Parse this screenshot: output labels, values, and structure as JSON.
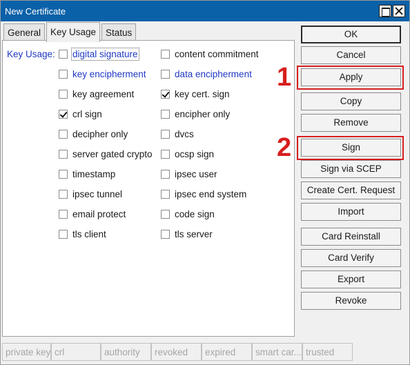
{
  "window": {
    "title": "New Certificate"
  },
  "tabs": [
    {
      "label": "General",
      "active": false
    },
    {
      "label": "Key Usage",
      "active": true
    },
    {
      "label": "Status",
      "active": false
    }
  ],
  "key_usage": {
    "label": "Key Usage:",
    "left": [
      {
        "label": "digital signature",
        "checked": false
      },
      {
        "label": "key encipherment",
        "checked": false
      },
      {
        "label": "key agreement",
        "checked": false
      },
      {
        "label": "crl sign",
        "checked": true
      },
      {
        "label": "decipher only",
        "checked": false
      },
      {
        "label": "server gated crypto",
        "checked": false
      },
      {
        "label": "timestamp",
        "checked": false
      },
      {
        "label": "ipsec tunnel",
        "checked": false
      },
      {
        "label": "email protect",
        "checked": false
      },
      {
        "label": "tls client",
        "checked": false
      }
    ],
    "right": [
      {
        "label": "content commitment",
        "checked": false
      },
      {
        "label": "data encipherment",
        "checked": false
      },
      {
        "label": "key cert. sign",
        "checked": true
      },
      {
        "label": "encipher only",
        "checked": false
      },
      {
        "label": "dvcs",
        "checked": false
      },
      {
        "label": "ocsp sign",
        "checked": false
      },
      {
        "label": "ipsec user",
        "checked": false
      },
      {
        "label": "ipsec end system",
        "checked": false
      },
      {
        "label": "code sign",
        "checked": false
      },
      {
        "label": "tls server",
        "checked": false
      }
    ]
  },
  "buttons": {
    "ok": "OK",
    "cancel": "Cancel",
    "apply": "Apply",
    "copy": "Copy",
    "remove": "Remove",
    "sign": "Sign",
    "sign_scep": "Sign via SCEP",
    "create_request": "Create Cert. Request",
    "import": "Import",
    "card_reinstall": "Card Reinstall",
    "card_verify": "Card Verify",
    "export": "Export",
    "revoke": "Revoke"
  },
  "annotations": {
    "marker_1": "1",
    "marker_2": "2",
    "color": "#d61e1e"
  },
  "status_bar": [
    "private key",
    "crl",
    "authority",
    "revoked",
    "expired",
    "smart car...",
    "trusted"
  ],
  "colors": {
    "title_bar": "#0b61a8",
    "link_blue": "#1f38c4"
  }
}
